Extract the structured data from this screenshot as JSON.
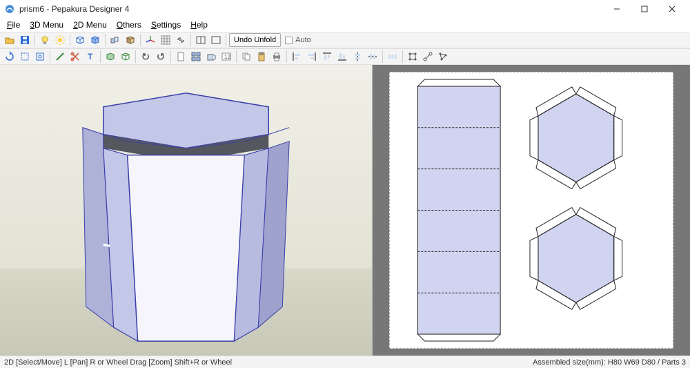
{
  "title": "prism6 - Pepakura Designer 4",
  "menu": {
    "file": "File",
    "menu3d": "3D Menu",
    "menu2d": "2D Menu",
    "others": "Others",
    "settings": "Settings",
    "help": "Help"
  },
  "toolbar1": {
    "undo_unfold": "Undo Unfold",
    "auto": "Auto"
  },
  "status": {
    "left": "2D [Select/Move] L [Pan] R or Wheel Drag [Zoom] Shift+R or Wheel",
    "right": "Assembled size(mm): H80 W69 D80 / Parts 3"
  },
  "colors": {
    "prism_fill": "#c3c7e8",
    "prism_dark": "#55575e",
    "prism_edge": "#3a3faa",
    "flat_fill": "#d1d4f0",
    "flat_edge": "#222"
  }
}
